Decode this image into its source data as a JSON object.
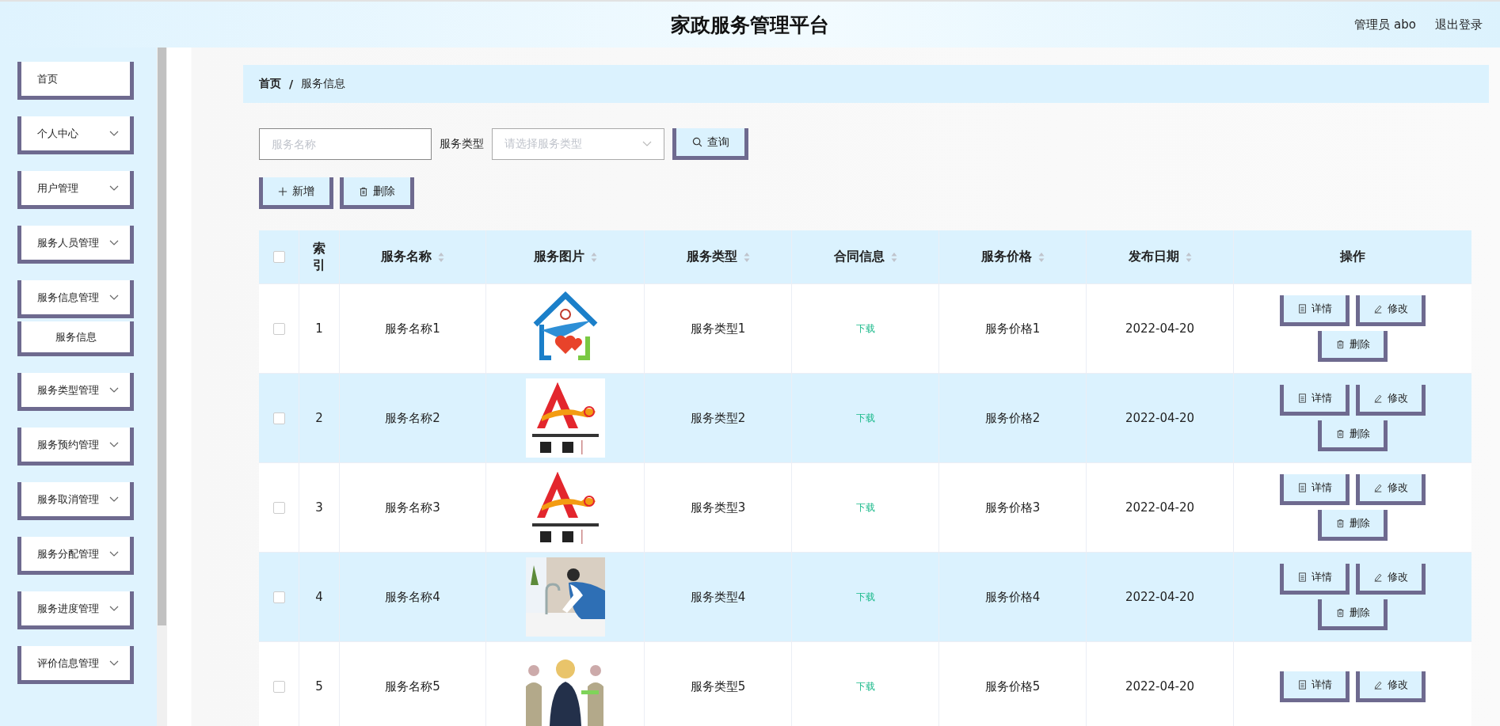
{
  "header": {
    "title": "家政服务管理平台",
    "user": "管理员 abo",
    "logout": "退出登录"
  },
  "sidebar": {
    "items": [
      {
        "label": "首页",
        "kind": "link"
      },
      {
        "label": "个人中心",
        "kind": "menu"
      },
      {
        "label": "用户管理",
        "kind": "menu"
      },
      {
        "label": "服务人员管理",
        "kind": "menu"
      },
      {
        "label": "服务信息管理",
        "kind": "menu"
      },
      {
        "label": "服务信息",
        "kind": "submenu"
      },
      {
        "label": "服务类型管理",
        "kind": "menu"
      },
      {
        "label": "服务预约管理",
        "kind": "menu"
      },
      {
        "label": "服务取消管理",
        "kind": "menu"
      },
      {
        "label": "服务分配管理",
        "kind": "menu"
      },
      {
        "label": "服务进度管理",
        "kind": "menu"
      },
      {
        "label": "评价信息管理",
        "kind": "menu"
      }
    ]
  },
  "breadcrumb": {
    "items": [
      "首页",
      "服务信息"
    ],
    "separator": "/"
  },
  "search": {
    "name_placeholder": "服务名称",
    "type_label": "服务类型",
    "type_placeholder": "请选择服务类型",
    "query_button": "查询"
  },
  "toolbar": {
    "add_button": "新增",
    "delete_button": "删除"
  },
  "table": {
    "select_all_checked": false,
    "columns": [
      {
        "kind": "checkbox"
      },
      {
        "label": "索引",
        "kind": "text",
        "sortable": false
      },
      {
        "label": "服务名称",
        "kind": "text",
        "sortable": true
      },
      {
        "label": "服务图片",
        "kind": "text",
        "sortable": true
      },
      {
        "label": "服务类型",
        "kind": "text",
        "sortable": true
      },
      {
        "label": "合同信息",
        "kind": "text",
        "sortable": true
      },
      {
        "label": "服务价格",
        "kind": "text",
        "sortable": true
      },
      {
        "label": "发布日期",
        "kind": "text",
        "sortable": true
      },
      {
        "label": "操作",
        "kind": "text",
        "sortable": false
      }
    ],
    "rows": [
      {
        "checked": false,
        "index": "1",
        "name": "服务名称1",
        "picture": {
          "kind": "picture"
        },
        "type": "服务类型1",
        "contract": "下载",
        "price": "服务价格1",
        "date": "2022-04-20",
        "actions": [
          "详情",
          "修改",
          "删除"
        ]
      },
      {
        "checked": false,
        "index": "2",
        "name": "服务名称2",
        "picture": {
          "kind": "picture"
        },
        "type": "服务类型2",
        "contract": "下载",
        "price": "服务价格2",
        "date": "2022-04-20",
        "actions": [
          "详情",
          "修改",
          "删除"
        ]
      },
      {
        "checked": false,
        "index": "3",
        "name": "服务名称3",
        "picture": {
          "kind": "picture"
        },
        "type": "服务类型3",
        "contract": "下载",
        "price": "服务价格3",
        "date": "2022-04-20",
        "actions": [
          "详情",
          "修改",
          "删除"
        ]
      },
      {
        "checked": false,
        "index": "4",
        "name": "服务名称4",
        "picture": {
          "kind": "picture"
        },
        "type": "服务类型4",
        "contract": "下载",
        "price": "服务价格4",
        "date": "2022-04-20",
        "actions": [
          "详情",
          "修改",
          "删除"
        ]
      },
      {
        "checked": false,
        "index": "5",
        "name": "服务名称5",
        "picture": {
          "kind": "picture"
        },
        "type": "服务类型5",
        "contract": "下载",
        "price": "服务价格5",
        "date": "2022-04-20",
        "actions": [
          "详情",
          "修改"
        ]
      }
    ]
  }
}
